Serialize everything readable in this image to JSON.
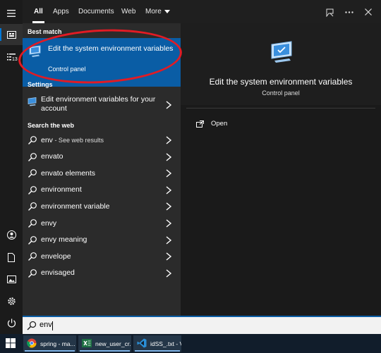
{
  "tabs": [
    "All",
    "Apps",
    "Documents",
    "Web",
    "More"
  ],
  "best_match": {
    "heading": "Best match",
    "title": "Edit the system environment variables",
    "subtitle": "Control panel"
  },
  "settings": {
    "heading": "Settings",
    "item": "Edit environment variables for your account"
  },
  "web": {
    "heading": "Search the web",
    "items": [
      {
        "text": "env",
        "hint": " - See web results"
      },
      {
        "text": "envato",
        "hint": ""
      },
      {
        "text": "envato elements",
        "hint": ""
      },
      {
        "text": "environment",
        "hint": ""
      },
      {
        "text": "environment variable",
        "hint": ""
      },
      {
        "text": "envy",
        "hint": ""
      },
      {
        "text": "envy meaning",
        "hint": ""
      },
      {
        "text": "envelope",
        "hint": ""
      },
      {
        "text": "envisaged",
        "hint": ""
      }
    ]
  },
  "preview": {
    "title": "Edit the system environment variables",
    "subtitle": "Control panel",
    "action_open": "Open"
  },
  "search": {
    "value": "env"
  },
  "rail": {
    "badge": "13"
  },
  "taskbar": {
    "items": [
      {
        "label": "spring - ma...",
        "icon": "chrome-icon"
      },
      {
        "label": "new_user_cr...",
        "icon": "excel-icon"
      },
      {
        "label": "idSS_.txt - V...",
        "icon": "vscode-icon"
      }
    ]
  },
  "colors": {
    "accent": "#0a5da5",
    "highlight_ring": "#e21b24",
    "panel": "#2b2b2b"
  }
}
